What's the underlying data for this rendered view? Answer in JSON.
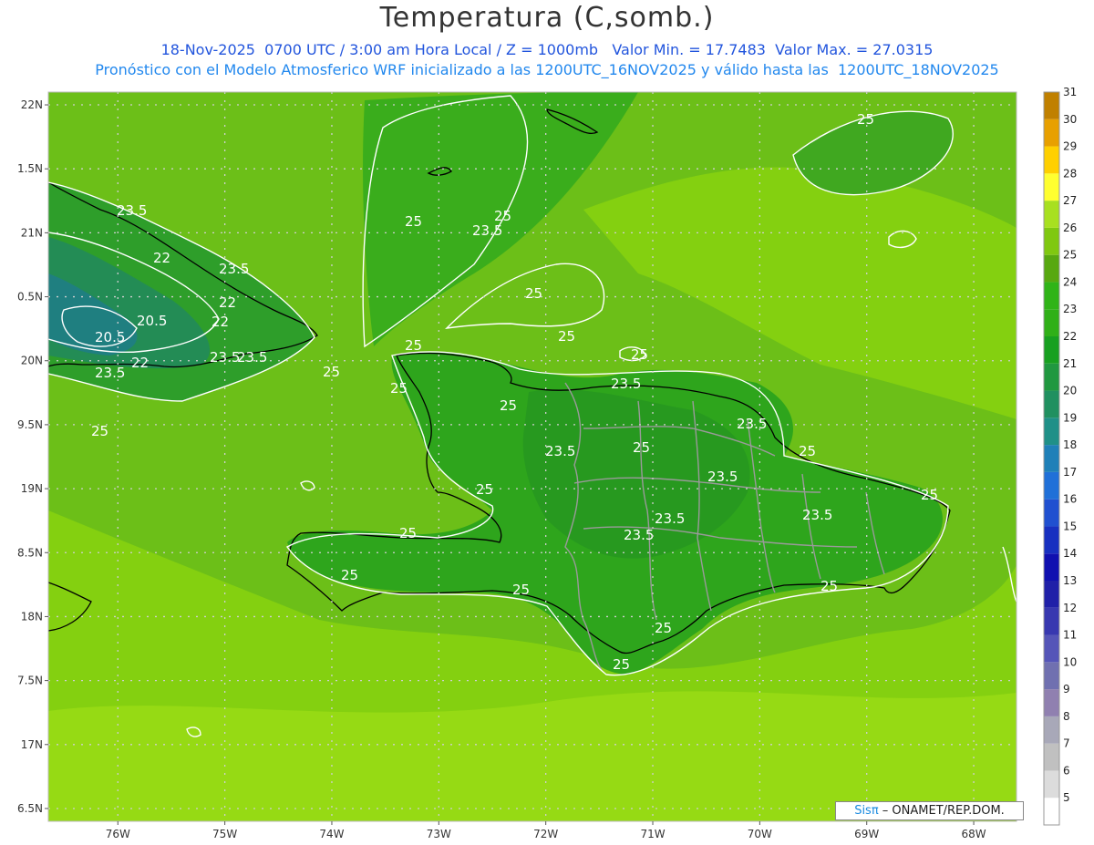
{
  "header": {
    "title": "Temperatura (C,somb.)",
    "line1": "18-Nov-2025  0700 UTC / 3:00 am Hora Local / Z = 1000mb   Valor Min. = 17.7483  Valor Max. = 27.0315",
    "line2": "Pronóstico con el Modelo Atmosferico WRF inicializado a las 1200UTC_16NOV2025 y válido hasta las  1200UTC_18NOV2025"
  },
  "map": {
    "lon_range": [
      -76.65,
      -67.6
    ],
    "lat_range": [
      16.4,
      22.1
    ],
    "lon_ticks": [
      "76W",
      "75W",
      "74W",
      "73W",
      "72W",
      "71W",
      "70W",
      "69W",
      "68W"
    ],
    "lat_ticks": [
      "22N",
      "1.5N",
      "21N",
      "0.5N",
      "20N",
      "9.5N",
      "19N",
      "8.5N",
      "18N",
      "7.5N",
      "17N",
      "6.5N"
    ],
    "contour_labels": [
      "23.5",
      "23.5",
      "22",
      "23.5",
      "22",
      "22",
      "20.5",
      "20.5",
      "23.5",
      "22",
      "23.5",
      "25",
      "25",
      "23.5",
      "25",
      "25",
      "25",
      "25",
      "25",
      "25",
      "25",
      "23.5",
      "25",
      "23.5",
      "25",
      "23.5",
      "25",
      "23.5",
      "25",
      "23.5",
      "23.5",
      "25",
      "25",
      "25",
      "25",
      "25",
      "25",
      "25",
      "23.5",
      "25"
    ]
  },
  "colorbar": {
    "levels": [
      "5",
      "6",
      "7",
      "8",
      "9",
      "10",
      "11",
      "12",
      "13",
      "14",
      "15",
      "16",
      "17",
      "18",
      "19",
      "20",
      "21",
      "22",
      "23",
      "24",
      "25",
      "26",
      "27",
      "28",
      "29",
      "30",
      "31"
    ],
    "colors": [
      "#ffffff",
      "#dcdcdc",
      "#c0c0c0",
      "#a8a8b8",
      "#9080b0",
      "#7070b0",
      "#5555b8",
      "#3838b0",
      "#2020a8",
      "#1010b0",
      "#1830c0",
      "#2050d0",
      "#2070d8",
      "#1f80b8",
      "#1f9088",
      "#209060",
      "#209840",
      "#18a020",
      "#30b018",
      "#30b418",
      "#58a810",
      "#80c810",
      "#a8e020",
      "#ffff30",
      "#ffd000",
      "#e8a000",
      "#c08000"
    ]
  },
  "credit": {
    "logo": "Sisπ",
    "text": " – ONAMET/REP.DOM."
  }
}
